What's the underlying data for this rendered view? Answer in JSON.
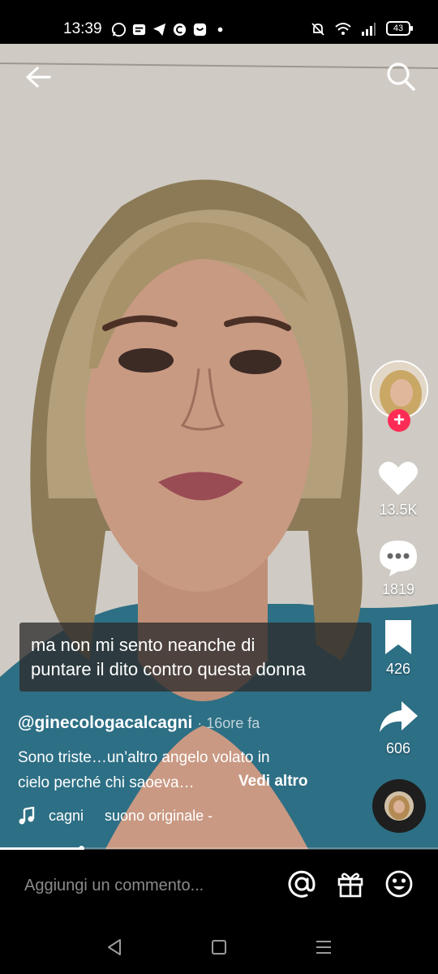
{
  "status_bar": {
    "time": "13:39",
    "battery": "43"
  },
  "video": {
    "caption_lines": [
      "ma non mi sento neanche di",
      "puntare il dito contro questa donna"
    ]
  },
  "rail": {
    "likes": "13.5K",
    "comments": "1819",
    "saves": "426",
    "shares": "606"
  },
  "post": {
    "author": "@ginecologacalcagni",
    "time_ago": "16ore fa",
    "description_line1": "Sono triste…un’altro angelo volato in",
    "description_line2": "cielo perché chi saoeva…",
    "see_more": "Vedi altro",
    "music_artist": "cagni",
    "music_title": "suono originale -"
  },
  "playback": {
    "progress": 0.185
  },
  "comment_bar": {
    "placeholder": "Aggiungi un commento..."
  },
  "icons": [
    "back-arrow-icon",
    "search-icon",
    "heart-icon",
    "comment-bubble-icon",
    "bookmark-icon",
    "share-icon",
    "music-note-icon",
    "at-icon",
    "gift-icon",
    "emoji-icon",
    "nav-back-icon",
    "nav-home-icon",
    "nav-recents-icon"
  ]
}
